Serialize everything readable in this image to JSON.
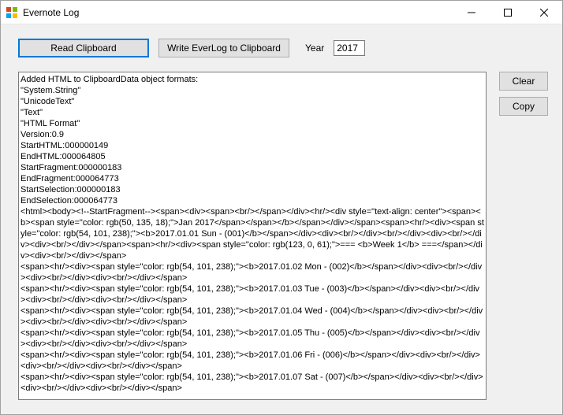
{
  "window": {
    "title": "Evernote Log"
  },
  "toolbar": {
    "read_label": "Read Clipboard",
    "write_label": "Write EverLog to Clipboard",
    "year_label": "Year",
    "year_value": "2017"
  },
  "side": {
    "clear_label": "Clear",
    "copy_label": "Copy"
  },
  "log_text": "Added HTML to ClipboardData object formats:\n\"System.String\"\n\"UnicodeText\"\n\"Text\"\n\"HTML Format\"\nVersion:0.9\nStartHTML:000000149\nEndHTML:000064805\nStartFragment:000000183\nEndFragment:000064773\nStartSelection:000000183\nEndSelection:000064773\n<html><body><!--StartFragment--><span><div><span><br/></span></div><hr/><div style=\"text-align: center\"><span><b><span style=\"color: rgb(50, 135, 18);\">Jan 2017</span></span></b></span></div></span><span><hr/><div><span style=\"color: rgb(54, 101, 238);\"><b>2017.01.01 Sun - (001)</b></span></div><div><br/></div><br/></div><div><br/></div><div><br/></div></span><span><hr/><div><span style=\"color: rgb(123, 0, 61);\">=== <b>Week 1</b> ===</span></div><div><br/></div></span>\n<span><hr/><div><span style=\"color: rgb(54, 101, 238);\"><b>2017.01.02 Mon - (002)</b></span></div><div><br/></div><div><br/></div><div><br/></div></span>\n<span><hr/><div><span style=\"color: rgb(54, 101, 238);\"><b>2017.01.03 Tue - (003)</b></span></div><div><br/></div><div><br/></div><div><br/></div></span>\n<span><hr/><div><span style=\"color: rgb(54, 101, 238);\"><b>2017.01.04 Wed - (004)</b></span></div><div><br/></div><div><br/></div><div><br/></div></span>\n<span><hr/><div><span style=\"color: rgb(54, 101, 238);\"><b>2017.01.05 Thu - (005)</b></span></div><div><br/></div><div><br/></div><div><br/></div></span>\n<span><hr/><div><span style=\"color: rgb(54, 101, 238);\"><b>2017.01.06 Fri - (006)</b></span></div><div><br/></div><div><br/></div><div><br/></div></span>\n<span><hr/><div><span style=\"color: rgb(54, 101, 238);\"><b>2017.01.07 Sat - (007)</b></span></div><div><br/></div><div><br/></div><div><br/></div></span>"
}
